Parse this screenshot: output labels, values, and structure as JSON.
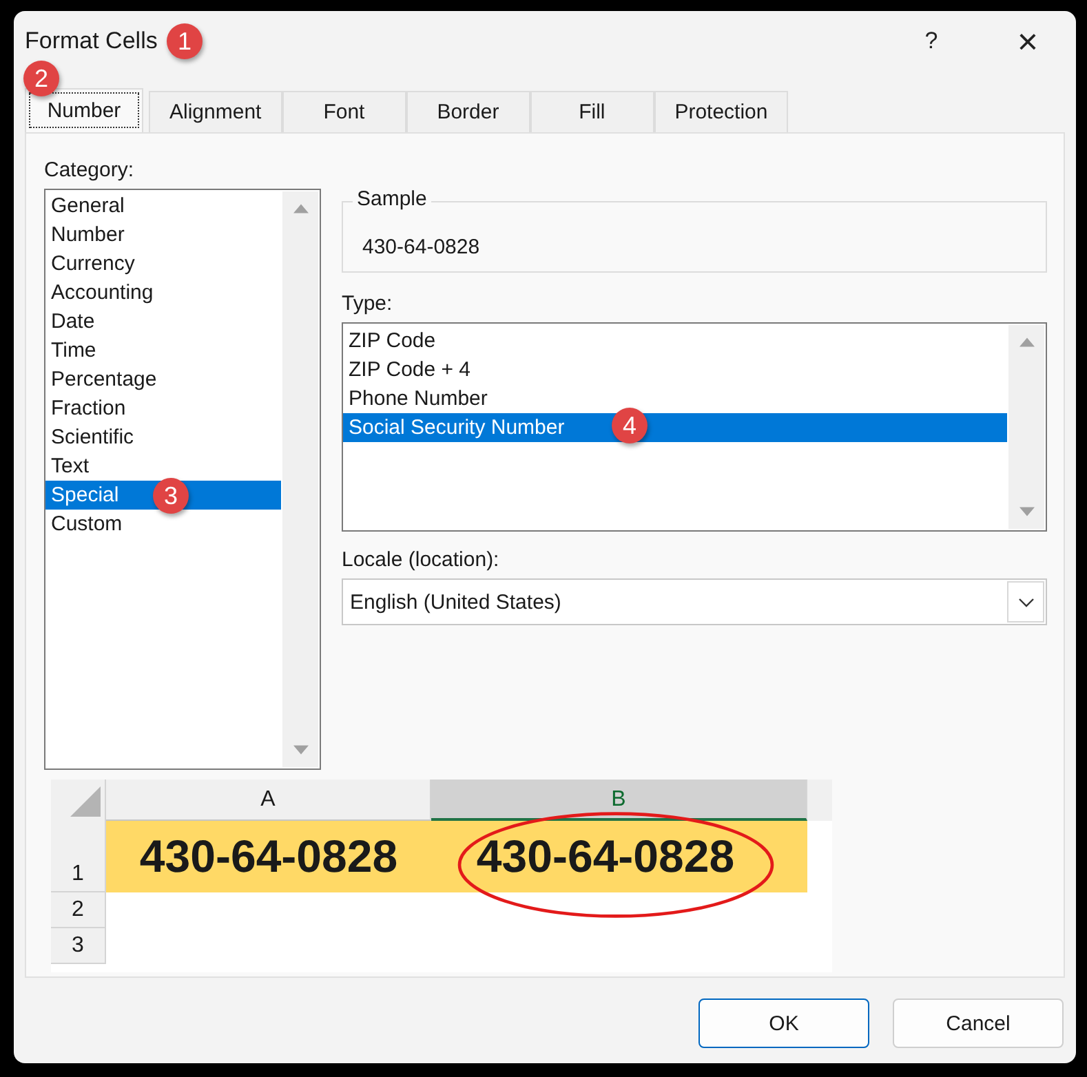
{
  "window": {
    "title": "Format Cells",
    "help": "?",
    "close": "×"
  },
  "tabs": [
    {
      "label": "Number",
      "selected": true
    },
    {
      "label": "Alignment",
      "selected": false
    },
    {
      "label": "Font",
      "selected": false
    },
    {
      "label": "Border",
      "selected": false
    },
    {
      "label": "Fill",
      "selected": false
    },
    {
      "label": "Protection",
      "selected": false
    }
  ],
  "category": {
    "label": "Category:",
    "items": [
      {
        "label": "General",
        "selected": false
      },
      {
        "label": "Number",
        "selected": false
      },
      {
        "label": "Currency",
        "selected": false
      },
      {
        "label": "Accounting",
        "selected": false
      },
      {
        "label": "Date",
        "selected": false
      },
      {
        "label": "Time",
        "selected": false
      },
      {
        "label": "Percentage",
        "selected": false
      },
      {
        "label": "Fraction",
        "selected": false
      },
      {
        "label": "Scientific",
        "selected": false
      },
      {
        "label": "Text",
        "selected": false
      },
      {
        "label": "Special",
        "selected": true
      },
      {
        "label": "Custom",
        "selected": false
      }
    ]
  },
  "sample": {
    "label": "Sample",
    "value": "430-64-0828"
  },
  "type": {
    "label": "Type:",
    "items": [
      {
        "label": "ZIP Code",
        "selected": false
      },
      {
        "label": "ZIP Code + 4",
        "selected": false
      },
      {
        "label": "Phone Number",
        "selected": false
      },
      {
        "label": "Social Security Number",
        "selected": true
      }
    ]
  },
  "locale": {
    "label": "Locale (location):",
    "value": "English (United States)"
  },
  "spreadsheet": {
    "columns": [
      {
        "label": "A",
        "selected": false
      },
      {
        "label": "B",
        "selected": true
      }
    ],
    "rows": [
      {
        "label": "1",
        "cells": [
          "430-64-0828",
          "430-64-0828"
        ]
      },
      {
        "label": "2",
        "cells": []
      },
      {
        "label": "3",
        "cells": []
      }
    ]
  },
  "badges": [
    "1",
    "2",
    "3",
    "4"
  ],
  "buttons": [
    {
      "label": "OK",
      "default": true
    },
    {
      "label": "Cancel",
      "default": false
    }
  ]
}
